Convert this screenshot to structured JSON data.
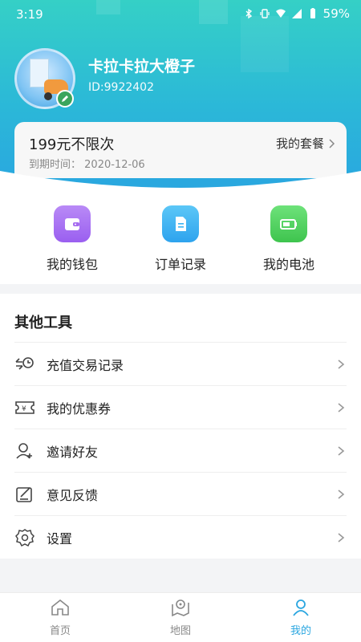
{
  "status_bar": {
    "time": "3:19",
    "battery": "59%"
  },
  "profile": {
    "name": "卡拉卡拉大橙子",
    "id": "ID:9922402"
  },
  "plan": {
    "title": "199元不限次",
    "expire_label": "到期时间：",
    "expire_date": "2020-12-06",
    "link_label": "我的套餐"
  },
  "quick_actions": [
    {
      "label": "我的钱包",
      "icon": "wallet-icon",
      "color": "#a66cf0"
    },
    {
      "label": "订单记录",
      "icon": "document-icon",
      "color": "#3ab3f2"
    },
    {
      "label": "我的电池",
      "icon": "battery-icon",
      "color": "#49d257"
    }
  ],
  "tools": {
    "title": "其他工具",
    "items": [
      {
        "label": "充值交易记录",
        "icon": "recharge-record-icon"
      },
      {
        "label": "我的优惠券",
        "icon": "coupon-icon"
      },
      {
        "label": "邀请好友",
        "icon": "invite-friend-icon"
      },
      {
        "label": "意见反馈",
        "icon": "feedback-icon"
      },
      {
        "label": "设置",
        "icon": "gear-icon"
      }
    ]
  },
  "tabbar": {
    "items": [
      {
        "label": "首页",
        "icon": "home-icon"
      },
      {
        "label": "地图",
        "icon": "map-icon"
      },
      {
        "label": "我的",
        "icon": "user-icon"
      }
    ],
    "active": "我的"
  },
  "colors": {
    "header_start": "#35d0c6",
    "header_end": "#2aa6e0",
    "accent": "#2aa6e0"
  }
}
